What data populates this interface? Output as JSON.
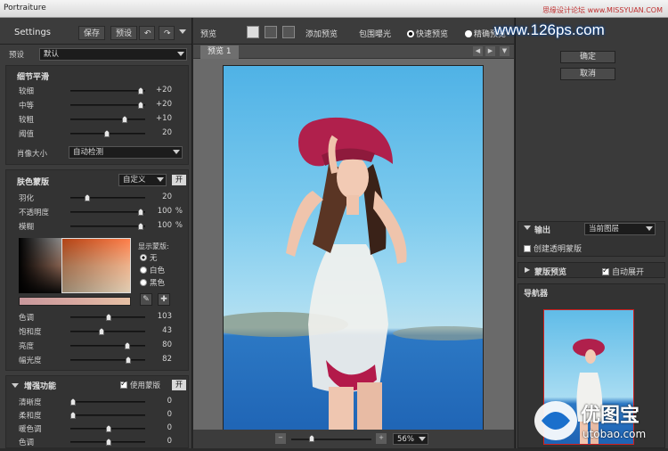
{
  "window_title": "Portraiture",
  "watermark_top": "思缘设计论坛 www.MISSYUAN.COM",
  "watermark_site": "www.126ps.com",
  "left": {
    "title": "Settings",
    "save": "保存",
    "preset_btn": "预设",
    "preset_label": "预设",
    "preset_value": "默认",
    "detail": {
      "title": "细节平滑",
      "rows": [
        {
          "label": "较细",
          "value": "+20",
          "pos": 0.95
        },
        {
          "label": "中等",
          "value": "+20",
          "pos": 0.95
        },
        {
          "label": "较粗",
          "value": "+10",
          "pos": 0.73
        },
        {
          "label": "阈值",
          "value": "20",
          "pos": 0.47
        }
      ],
      "portrait_size_label": "肖像大小",
      "portrait_size_value": "自动检测"
    },
    "skin": {
      "title": "肤色蒙版",
      "mode": "自定义",
      "on": "开",
      "rows": [
        {
          "label": "羽化",
          "value": "20",
          "unit": "",
          "pos": 0.2
        },
        {
          "label": "不透明度",
          "value": "100",
          "unit": "%",
          "pos": 0.95
        },
        {
          "label": "模糊",
          "value": "100",
          "unit": "%",
          "pos": 0.95
        }
      ],
      "show_mask_label": "显示蒙版:",
      "radios": [
        "无",
        "白色",
        "黑色"
      ],
      "color_rows": [
        {
          "label": "色调",
          "value": "103",
          "pos": 0.5
        },
        {
          "label": "饱和度",
          "value": "43",
          "pos": 0.4
        },
        {
          "label": "亮度",
          "value": "80",
          "pos": 0.76
        },
        {
          "label": "幅光度",
          "value": "82",
          "pos": 0.78
        }
      ]
    },
    "enhance": {
      "title": "增强功能",
      "use_mask": "使用蒙版",
      "on": "开",
      "rows": [
        {
          "label": "清晰度",
          "value": "0",
          "pos": 0.0
        },
        {
          "label": "柔和度",
          "value": "0",
          "pos": 0.0
        },
        {
          "label": "暖色调",
          "value": "0",
          "pos": 0.5
        },
        {
          "label": "色调",
          "value": "0",
          "pos": 0.5
        }
      ]
    }
  },
  "center": {
    "preview": "预览",
    "add_preview": "添加预览",
    "bracket": "包围曝光",
    "fast_preview": "快速预览",
    "accurate_preview": "精确预览",
    "tab": "预览 1",
    "zoom": "56%"
  },
  "right": {
    "ok": "确定",
    "cancel": "取消",
    "output_label": "输出",
    "output_value": "当前图层",
    "create_mask": "创建透明蒙版",
    "mask_preview": "蒙版预览",
    "auto_expand": "自动展开",
    "navigator": "导航器"
  },
  "logo": {
    "cn": "优图宝",
    "en": "utobao.com"
  }
}
